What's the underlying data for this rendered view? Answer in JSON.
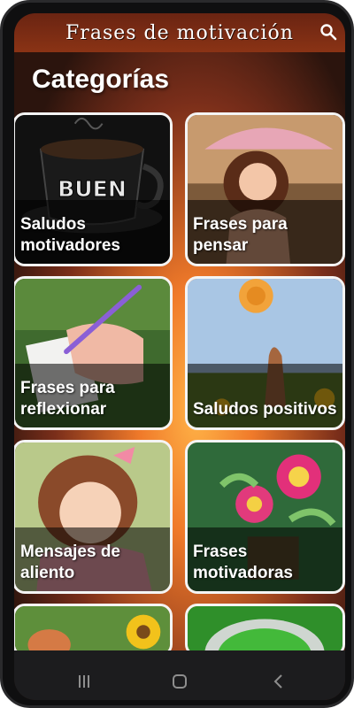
{
  "app": {
    "title": "Frases de motivación"
  },
  "toolbar": {
    "search_icon": "search-icon"
  },
  "main": {
    "heading": "Categorías"
  },
  "categories": [
    {
      "label": "Saludos motivadores"
    },
    {
      "label": "Frases para pensar"
    },
    {
      "label": "Frases para reflexionar"
    },
    {
      "label": "Saludos positivos"
    },
    {
      "label": "Mensajes de aliento"
    },
    {
      "label": "Frases motivadoras"
    }
  ],
  "images": {
    "coffee_cup_text": "BUEN DÍA"
  },
  "colors": {
    "titlebar": "#7a2c13",
    "card_border": "#f4f4f4",
    "text": "#ffffff"
  }
}
